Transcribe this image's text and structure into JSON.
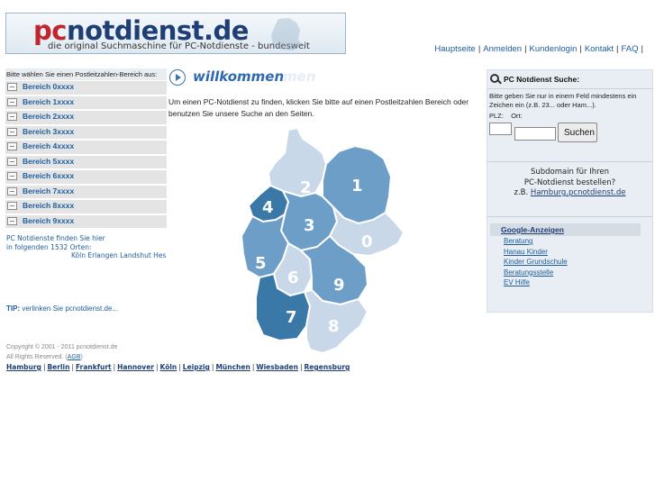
{
  "logo": {
    "brand_pc": "pc",
    "brand_rest": "notdienst.de",
    "tagline": "die original Suchmaschine für PC-Notdienste - bundesweit"
  },
  "topnav": [
    "Hauptseite",
    "Anmelden",
    "Kundenlogin",
    "Kontakt",
    "FAQ"
  ],
  "left": {
    "hint": "Bitte wählen Sie einen Postleitzahlen-Bereich aus:",
    "bereiche": [
      "Bereich 0xxxx",
      "Bereich 1xxxx",
      "Bereich 2xxxx",
      "Bereich 3xxxx",
      "Bereich 4xxxx",
      "Bereich 5xxxx",
      "Bereich 6xxxx",
      "Bereich 7xxxx",
      "Bereich 8xxxx",
      "Bereich 9xxxx"
    ],
    "orte_line1": "PC Notdienste finden Sie hier",
    "orte_line2": "in folgenden 1532 Orten:",
    "orte_cities": "Köln Erlangen Landshut Hes",
    "tip_label": "TIP:",
    "tip_text": " verlinken Sie pcnotdienst.de...",
    "copyright": "Copyright © 2001 - 2011 pcnotdienst.de",
    "rights": "All Rights Reserved. (",
    "agb": "AGB",
    "rights_end": ")",
    "city_links": [
      "Hamburg",
      "Berlin",
      "Frankfurt",
      "Hannover",
      "Köln",
      "Leipzig",
      "München",
      "Wiesbaden",
      "Regensburg"
    ]
  },
  "center": {
    "welcome": "willkommen",
    "welcome_ghost": "men",
    "intro": "Um einen PC-Notdienst zu finden, klicken Sie bitte auf einen Postleitzahlen Bereich oder benutzen Sie unsere Suche an den Seiten.",
    "map_labels": [
      "0",
      "1",
      "2",
      "3",
      "4",
      "5",
      "6",
      "7",
      "8",
      "9"
    ]
  },
  "right": {
    "search_title": "PC Notdienst Suche:",
    "search_desc": "Bitte geben Sie nur in einem Feld mindestens ein Zeichen ein (z.B. 23... oder Ham...).",
    "plz_label": "PLZ:",
    "ort_label": "Ort:",
    "plz_value": "",
    "ort_value": "",
    "search_button": "Suchen",
    "sub_line1": "Subdomain für Ihren",
    "sub_line2": "PC-Notdienst bestellen?",
    "sub_prefix": "z.B. ",
    "sub_example": "Hamburg.pcnotdienst.de",
    "ads_title": "Google-Anzeigen",
    "ads": [
      "Beratung",
      "Hanau Kinder",
      "Kinder Grundschule",
      "Beratungsstelle",
      "EV Hilfe"
    ]
  },
  "colors": {
    "map_dark": "#3a78a8",
    "map_mid": "#6c9ec8",
    "map_light": "#c8d8e8",
    "link": "#1d5d9c"
  }
}
